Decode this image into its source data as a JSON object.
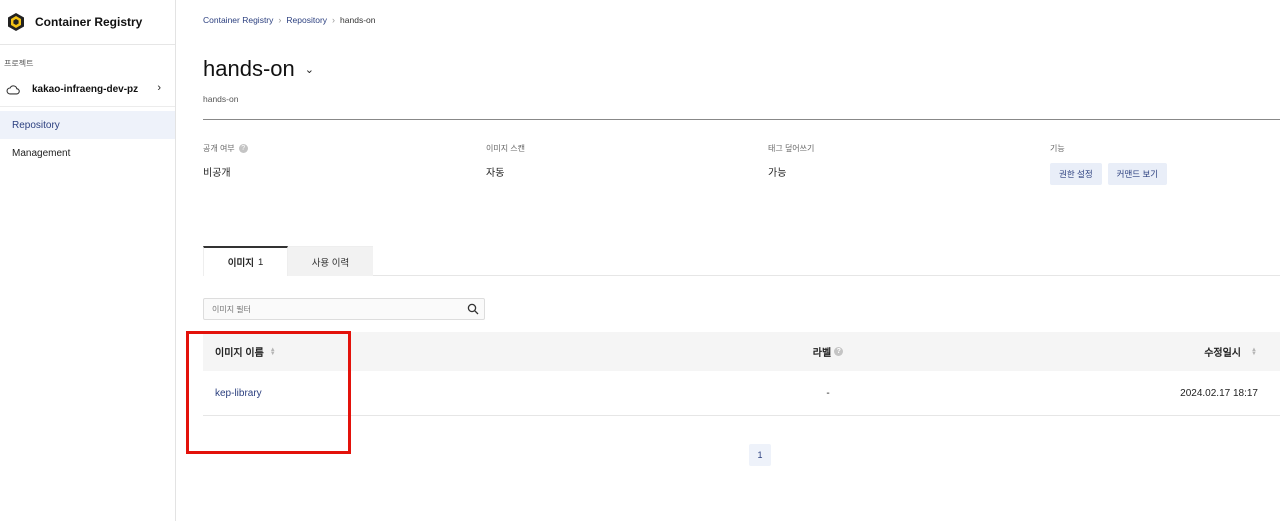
{
  "app": {
    "title": "Container Registry"
  },
  "sidebar": {
    "section_label": "프로젝트",
    "project_name": "kakao-infraeng-dev-pz",
    "items": [
      {
        "label": "Repository",
        "active": true
      },
      {
        "label": "Management",
        "active": false
      }
    ]
  },
  "breadcrumb": {
    "items": [
      "Container Registry",
      "Repository",
      "hands-on"
    ]
  },
  "page": {
    "title": "hands-on",
    "subtitle": "hands-on"
  },
  "info": {
    "visibility": {
      "label": "공개 여부",
      "value": "비공개"
    },
    "image_scan": {
      "label": "이미지 스캔",
      "value": "자동"
    },
    "tag_overwrite": {
      "label": "태그 덮어쓰기",
      "value": "가능"
    },
    "functions": {
      "label": "기능",
      "buttons": [
        "권한 설정",
        "커맨드 보기"
      ]
    }
  },
  "tabs": [
    {
      "label": "이미지",
      "count": "1",
      "active": true
    },
    {
      "label": "사용 이력",
      "active": false
    }
  ],
  "filter": {
    "placeholder": "이미지 필터"
  },
  "table": {
    "headers": {
      "name": "이미지 이름",
      "label": "라벨",
      "updated": "수정일시"
    },
    "rows": [
      {
        "name": "kep-library",
        "label": "-",
        "updated": "2024.02.17 18:17"
      }
    ]
  },
  "pagination": {
    "current": "1"
  },
  "colors": {
    "accent": "#2b3f7f",
    "highlight": "#e3120b",
    "active_bg": "#eef2fa"
  }
}
